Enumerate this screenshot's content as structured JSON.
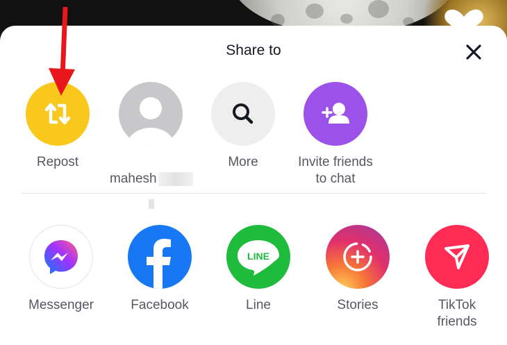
{
  "sheet": {
    "title": "Share to",
    "close_label": "close"
  },
  "contacts": [
    {
      "label": "Repost",
      "icon": "repost-icon",
      "color": "#f9c81c"
    },
    {
      "label": "mahesh",
      "icon": "avatar-placeholder-icon",
      "color": "#c8c8cb"
    },
    {
      "label": "More",
      "icon": "search-icon",
      "color": "#eeeeef"
    },
    {
      "label": "Invite friends\nto chat",
      "icon": "add-user-icon",
      "color": "#9b52e8"
    }
  ],
  "apps": [
    {
      "label": "Messenger",
      "icon": "messenger-icon"
    },
    {
      "label": "Facebook",
      "icon": "facebook-icon",
      "color": "#1877f2"
    },
    {
      "label": "Line",
      "icon": "line-icon",
      "color": "#1ebb3c",
      "badge": "LINE"
    },
    {
      "label": "Stories",
      "icon": "instagram-stories-icon"
    },
    {
      "label": "TikTok\nfriends",
      "icon": "send-icon",
      "color": "#fe2c55"
    }
  ],
  "annotation": {
    "color": "#e8171b",
    "icon": "red-arrow-annotation"
  }
}
